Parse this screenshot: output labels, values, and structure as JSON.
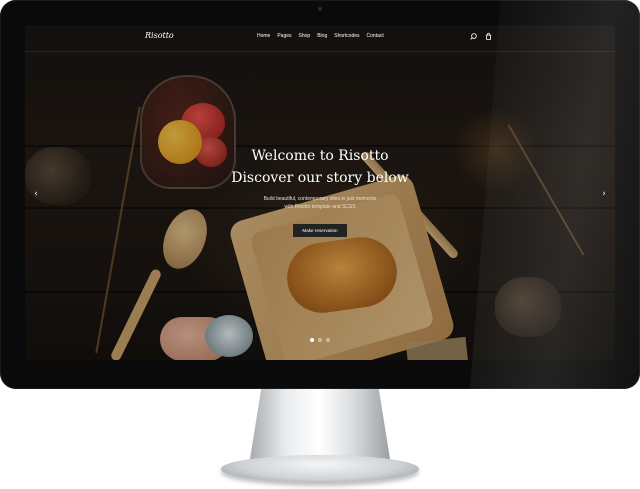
{
  "site": {
    "logo": "Risotto",
    "nav": [
      "Home",
      "Pages",
      "Shop",
      "Blog",
      "Shortcodes",
      "Contact"
    ],
    "icons": [
      "search-icon",
      "cart-icon"
    ]
  },
  "hero": {
    "title_line1": "Welcome to Risotto",
    "title_line2": "Discover our story below",
    "subtitle_line1": "Build beautiful, contemporary sites in just moments",
    "subtitle_line2": "with Risotto template and SCSS",
    "cta_label": "Make reservation",
    "slides_total": 3,
    "active_slide": 1
  },
  "colors": {
    "accent": "#222222",
    "text": "#ffffff"
  }
}
